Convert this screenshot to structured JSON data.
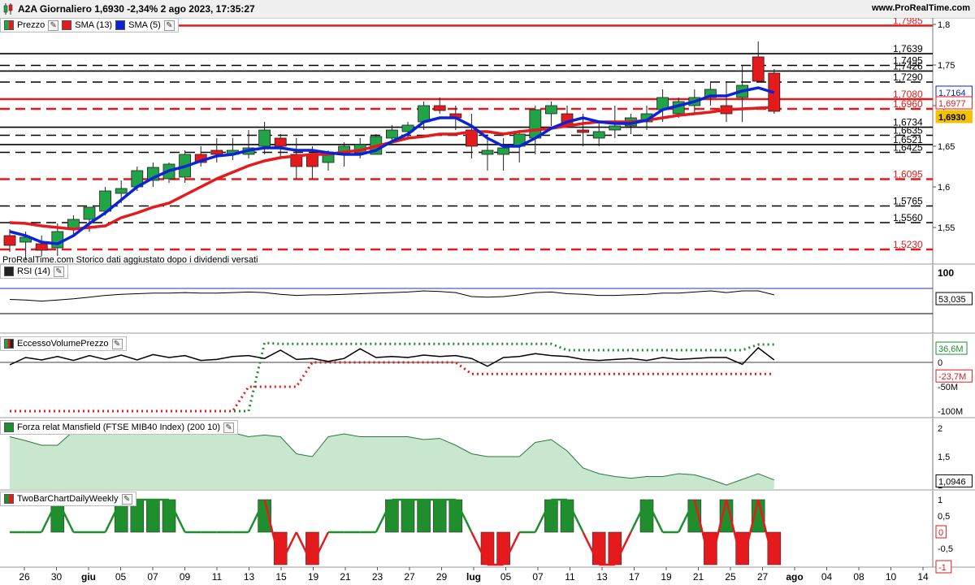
{
  "header": {
    "title": "A2A Giornaliero 1,6930 -2,34% 2 ago 2023, 17:35:27",
    "site": "www.ProRealTime.com"
  },
  "price_panel": {
    "legend": {
      "price": "Prezzo",
      "sma13": "SMA (13)",
      "sma5": "SMA (5)"
    },
    "note": "ProRealTime.com Storico dati aggiustato dopo i dividendi versati",
    "axis_ticks": [
      "1,8",
      "1,75",
      "1,7",
      "1,65",
      "1,6",
      "1,55"
    ],
    "axis_values": [
      1.8,
      1.75,
      1.7,
      1.65,
      1.6,
      1.55
    ],
    "labels": {
      "sma5_value": "1,7164",
      "sma13_value": "1,6977",
      "last_price": "1,6930"
    },
    "levels": [
      {
        "value": 1.7985,
        "label": "1,7985",
        "color": "#e41a1c",
        "style": "solid"
      },
      {
        "value": 1.7639,
        "label": "1,7639",
        "color": "#000000",
        "style": "solid"
      },
      {
        "value": 1.7495,
        "label": "1,7495",
        "color": "#000000",
        "style": "dashed"
      },
      {
        "value": 1.7426,
        "label": "1,7426",
        "color": "#000000",
        "style": "solid"
      },
      {
        "value": 1.729,
        "label": "1,7290",
        "color": "#000000",
        "style": "dashed"
      },
      {
        "value": 1.708,
        "label": "1,7080",
        "color": "#e41a1c",
        "style": "solid"
      },
      {
        "value": 1.696,
        "label": "1,6960",
        "color": "#e41a1c",
        "style": "dashed"
      },
      {
        "value": 1.6734,
        "label": "1,6734",
        "color": "#000000",
        "style": "solid"
      },
      {
        "value": 1.6635,
        "label": "1,6635",
        "color": "#000000",
        "style": "dashed"
      },
      {
        "value": 1.6521,
        "label": "1,6521",
        "color": "#000000",
        "style": "solid"
      },
      {
        "value": 1.6425,
        "label": "1,6425",
        "color": "#000000",
        "style": "dashed"
      },
      {
        "value": 1.6095,
        "label": "1,6095",
        "color": "#e41a1c",
        "style": "dashed"
      },
      {
        "value": 1.5765,
        "label": "1,5765",
        "color": "#000000",
        "style": "dashed"
      },
      {
        "value": 1.556,
        "label": "1,5560",
        "color": "#000000",
        "style": "dashed"
      },
      {
        "value": 1.523,
        "label": "1,5230",
        "color": "#e41a1c",
        "style": "dashed"
      }
    ]
  },
  "rsi_panel": {
    "legend": "RSI (14)",
    "axis_ticks": [
      "100"
    ],
    "value_label": "53,035"
  },
  "volume_panel": {
    "legend": "EccessoVolumePrezzo",
    "axis_ticks": [
      "0",
      "-50M",
      "-100M"
    ],
    "labels": {
      "upper": "36,6M",
      "lower": "-23,7M"
    }
  },
  "mansfield_panel": {
    "legend": "Forza relat Mansfield (FTSE MIB40 Index) (200 10)",
    "axis_ticks": [
      "2",
      "1,5",
      "1"
    ],
    "value_label": "1,0946"
  },
  "twobar_panel": {
    "legend": "TwoBarChartDailyWeekly",
    "axis_ticks": [
      "1",
      "0,5",
      "-0,5"
    ],
    "labels": {
      "zero": "0",
      "minus_one": "-1"
    }
  },
  "x_axis": {
    "labels": [
      "26",
      "30",
      "giu",
      "05",
      "07",
      "09",
      "11",
      "13",
      "15",
      "19",
      "21",
      "23",
      "27",
      "29",
      "lug",
      "05",
      "07",
      "11",
      "13",
      "17",
      "19",
      "21",
      "25",
      "27",
      "ago",
      "04",
      "08",
      "10",
      "14"
    ]
  },
  "colors": {
    "up": "#21a447",
    "down": "#e41a1c",
    "sma5": "#0a23d9",
    "sma13": "#e41a1c",
    "mansfield_fill": "#bfe3c6",
    "twobar_up": "#1f8f2e",
    "twobar_down": "#e41a1c"
  },
  "chart_data": {
    "type": "candlestick",
    "x": [
      "26 mag",
      "29 mag",
      "30 mag",
      "31 mag",
      "1 giu",
      "2 giu",
      "5 giu",
      "6 giu",
      "7 giu",
      "8 giu",
      "9 giu",
      "12 giu",
      "13 giu",
      "14 giu",
      "15 giu",
      "16 giu",
      "19 giu",
      "20 giu",
      "21 giu",
      "22 giu",
      "23 giu",
      "26 giu",
      "27 giu",
      "28 giu",
      "29 giu",
      "30 giu",
      "3 lug",
      "4 lug",
      "5 lug",
      "6 lug",
      "7 lug",
      "10 lug",
      "11 lug",
      "12 lug",
      "13 lug",
      "14 lug",
      "17 lug",
      "18 lug",
      "19 lug",
      "20 lug",
      "21 lug",
      "24 lug",
      "25 lug",
      "26 lug",
      "27 lug",
      "28 lug",
      "31 lug",
      "1 ago",
      "2 ago"
    ],
    "open": [
      1.54,
      1.532,
      1.53,
      1.525,
      1.548,
      1.56,
      1.57,
      1.592,
      1.6,
      1.608,
      1.61,
      1.612,
      1.64,
      1.645,
      1.64,
      1.64,
      1.65,
      1.66,
      1.64,
      1.64,
      1.63,
      1.64,
      1.642,
      1.64,
      1.66,
      1.668,
      1.68,
      1.7,
      1.69,
      1.67,
      1.64,
      1.64,
      1.65,
      1.66,
      1.69,
      1.69,
      1.67,
      1.66,
      1.67,
      1.675,
      1.68,
      1.695,
      1.69,
      1.7,
      1.71,
      1.7,
      1.71,
      1.76,
      1.74
    ],
    "high": [
      1.548,
      1.545,
      1.54,
      1.555,
      1.565,
      1.575,
      1.6,
      1.608,
      1.625,
      1.63,
      1.63,
      1.645,
      1.65,
      1.66,
      1.66,
      1.67,
      1.68,
      1.665,
      1.66,
      1.65,
      1.645,
      1.655,
      1.66,
      1.665,
      1.676,
      1.68,
      1.705,
      1.71,
      1.7,
      1.69,
      1.66,
      1.66,
      1.67,
      1.7,
      1.705,
      1.7,
      1.69,
      1.68,
      1.7,
      1.69,
      1.7,
      1.72,
      1.71,
      1.72,
      1.73,
      1.73,
      1.75,
      1.779,
      1.745
    ],
    "low": [
      1.52,
      1.51,
      1.515,
      1.515,
      1.538,
      1.545,
      1.565,
      1.58,
      1.595,
      1.6,
      1.605,
      1.605,
      1.625,
      1.63,
      1.633,
      1.635,
      1.64,
      1.635,
      1.61,
      1.61,
      1.62,
      1.625,
      1.635,
      1.64,
      1.655,
      1.66,
      1.67,
      1.69,
      1.67,
      1.635,
      1.62,
      1.62,
      1.63,
      1.64,
      1.675,
      1.68,
      1.65,
      1.65,
      1.66,
      1.665,
      1.67,
      1.68,
      1.685,
      1.69,
      1.7,
      1.68,
      1.68,
      1.73,
      1.69
    ],
    "close": [
      1.528,
      1.538,
      1.522,
      1.545,
      1.56,
      1.575,
      1.595,
      1.598,
      1.62,
      1.624,
      1.628,
      1.64,
      1.63,
      1.64,
      1.645,
      1.648,
      1.67,
      1.65,
      1.625,
      1.625,
      1.64,
      1.65,
      1.652,
      1.662,
      1.67,
      1.676,
      1.7,
      1.694,
      1.685,
      1.65,
      1.645,
      1.648,
      1.665,
      1.695,
      1.7,
      1.675,
      1.667,
      1.668,
      1.675,
      1.685,
      1.69,
      1.71,
      1.705,
      1.71,
      1.72,
      1.69,
      1.725,
      1.73,
      1.693
    ],
    "sma5": [
      1.545,
      1.54,
      1.532,
      1.53,
      1.54,
      1.555,
      1.568,
      1.584,
      1.6,
      1.611,
      1.62,
      1.625,
      1.632,
      1.638,
      1.64,
      1.645,
      1.648,
      1.648,
      1.645,
      1.645,
      1.642,
      1.64,
      1.64,
      1.645,
      1.656,
      1.665,
      1.68,
      1.685,
      1.685,
      1.675,
      1.66,
      1.65,
      1.65,
      1.66,
      1.672,
      1.68,
      1.685,
      1.68,
      1.678,
      1.678,
      1.682,
      1.695,
      1.7,
      1.705,
      1.712,
      1.712,
      1.718,
      1.722,
      1.716
    ],
    "sma13": [
      1.556,
      1.555,
      1.552,
      1.55,
      1.548,
      1.55,
      1.552,
      1.562,
      1.568,
      1.575,
      1.58,
      1.59,
      1.6,
      1.61,
      1.618,
      1.626,
      1.632,
      1.636,
      1.638,
      1.64,
      1.64,
      1.643,
      1.645,
      1.65,
      1.655,
      1.66,
      1.662,
      1.665,
      1.665,
      1.668,
      1.668,
      1.665,
      1.668,
      1.67,
      1.672,
      1.675,
      1.678,
      1.68,
      1.68,
      1.68,
      1.682,
      1.685,
      1.688,
      1.69,
      1.692,
      1.695,
      1.696,
      1.697,
      1.698
    ],
    "rsi": [
      45,
      44,
      42,
      44,
      46,
      49,
      52,
      54,
      55,
      56,
      56,
      57,
      56,
      56,
      57,
      58,
      57,
      54,
      52,
      53,
      53,
      54,
      55,
      56,
      57,
      58,
      60,
      59,
      57,
      50,
      49,
      50,
      53,
      57,
      58,
      55,
      54,
      52,
      52,
      53,
      54,
      56,
      56,
      58,
      60,
      57,
      60,
      60,
      53
    ],
    "volume_excess": [
      -5,
      10,
      5,
      12,
      4,
      14,
      6,
      15,
      5,
      16,
      10,
      14,
      4,
      6,
      12,
      14,
      8,
      25,
      6,
      8,
      2,
      8,
      28,
      10,
      12,
      10,
      15,
      12,
      14,
      8,
      -8,
      10,
      12,
      18,
      14,
      12,
      6,
      4,
      6,
      8,
      4,
      10,
      6,
      8,
      10,
      10,
      -4,
      30,
      5
    ],
    "volume_upper": [
      -100,
      -100,
      -100,
      -100,
      -100,
      -100,
      -100,
      -100,
      -100,
      -100,
      -100,
      -100,
      -100,
      -100,
      -100,
      -100,
      40,
      38,
      38,
      38,
      38,
      38,
      38,
      38,
      38,
      38,
      38,
      38,
      38,
      38,
      38,
      38,
      38,
      38,
      38,
      25,
      25,
      25,
      25,
      25,
      25,
      25,
      25,
      25,
      25,
      25,
      25,
      36.6,
      36.6
    ],
    "volume_lower": [
      -100,
      -100,
      -100,
      -100,
      -100,
      -100,
      -100,
      -100,
      -100,
      -100,
      -100,
      -100,
      -100,
      -100,
      -100,
      -50,
      -50,
      -50,
      -50,
      0,
      0,
      0,
      0,
      0,
      0,
      0,
      0,
      0,
      0,
      -23.7,
      -23.7,
      -23.7,
      -23.7,
      -23.7,
      -23.7,
      -23.7,
      -23.7,
      -23.7,
      -23.7,
      -23.7,
      -23.7,
      -23.7,
      -23.7,
      -23.7,
      -23.7,
      -23.7,
      -23.7,
      -23.7,
      -23.7
    ],
    "mansfield": [
      1.85,
      1.78,
      1.7,
      1.7,
      1.95,
      2.0,
      2.0,
      1.95,
      1.95,
      1.95,
      1.95,
      1.9,
      1.95,
      1.95,
      1.92,
      1.85,
      1.88,
      1.85,
      1.55,
      1.5,
      1.85,
      1.9,
      1.85,
      1.85,
      1.85,
      1.85,
      1.8,
      1.82,
      1.7,
      1.55,
      1.5,
      1.5,
      1.5,
      1.75,
      1.8,
      1.6,
      1.3,
      1.2,
      1.15,
      1.12,
      1.15,
      1.15,
      1.2,
      1.18,
      1.1,
      1.0,
      1.1,
      1.2,
      1.09
    ],
    "twobar": [
      0,
      0,
      0,
      1,
      0,
      0,
      0,
      1,
      1,
      1,
      1,
      0,
      0,
      0,
      0,
      0,
      1,
      -1,
      0,
      -1,
      0,
      0,
      0,
      0,
      1,
      1,
      1,
      1,
      1,
      0,
      -1,
      -1,
      0,
      0,
      1,
      1,
      0,
      -1,
      -1,
      0,
      1,
      0,
      0,
      1,
      -1,
      1,
      -1,
      1,
      -1
    ]
  }
}
